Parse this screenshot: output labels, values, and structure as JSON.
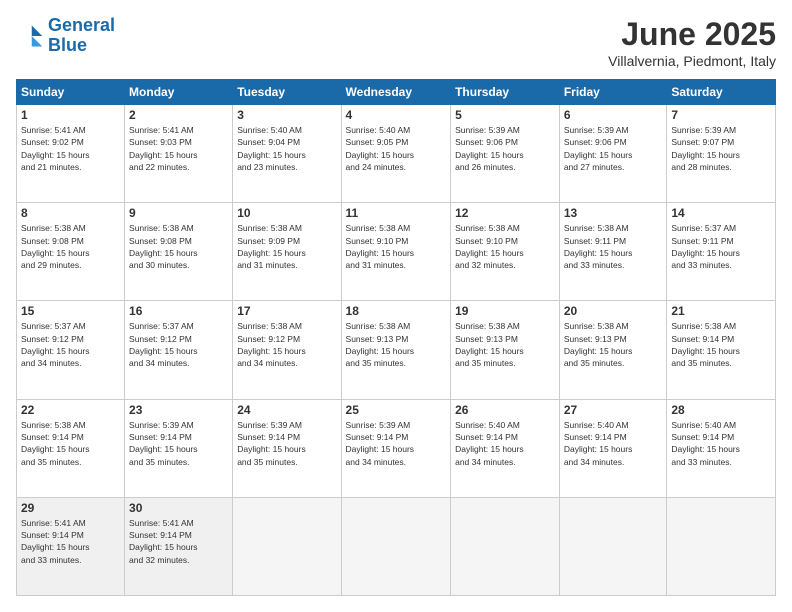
{
  "logo": {
    "line1": "General",
    "line2": "Blue"
  },
  "title": "June 2025",
  "subtitle": "Villalvernia, Piedmont, Italy",
  "weekdays": [
    "Sunday",
    "Monday",
    "Tuesday",
    "Wednesday",
    "Thursday",
    "Friday",
    "Saturday"
  ],
  "weeks": [
    [
      {
        "day": "1",
        "info": "Sunrise: 5:41 AM\nSunset: 9:02 PM\nDaylight: 15 hours\nand 21 minutes."
      },
      {
        "day": "2",
        "info": "Sunrise: 5:41 AM\nSunset: 9:03 PM\nDaylight: 15 hours\nand 22 minutes."
      },
      {
        "day": "3",
        "info": "Sunrise: 5:40 AM\nSunset: 9:04 PM\nDaylight: 15 hours\nand 23 minutes."
      },
      {
        "day": "4",
        "info": "Sunrise: 5:40 AM\nSunset: 9:05 PM\nDaylight: 15 hours\nand 24 minutes."
      },
      {
        "day": "5",
        "info": "Sunrise: 5:39 AM\nSunset: 9:06 PM\nDaylight: 15 hours\nand 26 minutes."
      },
      {
        "day": "6",
        "info": "Sunrise: 5:39 AM\nSunset: 9:06 PM\nDaylight: 15 hours\nand 27 minutes."
      },
      {
        "day": "7",
        "info": "Sunrise: 5:39 AM\nSunset: 9:07 PM\nDaylight: 15 hours\nand 28 minutes."
      }
    ],
    [
      {
        "day": "8",
        "info": "Sunrise: 5:38 AM\nSunset: 9:08 PM\nDaylight: 15 hours\nand 29 minutes."
      },
      {
        "day": "9",
        "info": "Sunrise: 5:38 AM\nSunset: 9:08 PM\nDaylight: 15 hours\nand 30 minutes."
      },
      {
        "day": "10",
        "info": "Sunrise: 5:38 AM\nSunset: 9:09 PM\nDaylight: 15 hours\nand 31 minutes."
      },
      {
        "day": "11",
        "info": "Sunrise: 5:38 AM\nSunset: 9:10 PM\nDaylight: 15 hours\nand 31 minutes."
      },
      {
        "day": "12",
        "info": "Sunrise: 5:38 AM\nSunset: 9:10 PM\nDaylight: 15 hours\nand 32 minutes."
      },
      {
        "day": "13",
        "info": "Sunrise: 5:38 AM\nSunset: 9:11 PM\nDaylight: 15 hours\nand 33 minutes."
      },
      {
        "day": "14",
        "info": "Sunrise: 5:37 AM\nSunset: 9:11 PM\nDaylight: 15 hours\nand 33 minutes."
      }
    ],
    [
      {
        "day": "15",
        "info": "Sunrise: 5:37 AM\nSunset: 9:12 PM\nDaylight: 15 hours\nand 34 minutes."
      },
      {
        "day": "16",
        "info": "Sunrise: 5:37 AM\nSunset: 9:12 PM\nDaylight: 15 hours\nand 34 minutes."
      },
      {
        "day": "17",
        "info": "Sunrise: 5:38 AM\nSunset: 9:12 PM\nDaylight: 15 hours\nand 34 minutes."
      },
      {
        "day": "18",
        "info": "Sunrise: 5:38 AM\nSunset: 9:13 PM\nDaylight: 15 hours\nand 35 minutes."
      },
      {
        "day": "19",
        "info": "Sunrise: 5:38 AM\nSunset: 9:13 PM\nDaylight: 15 hours\nand 35 minutes."
      },
      {
        "day": "20",
        "info": "Sunrise: 5:38 AM\nSunset: 9:13 PM\nDaylight: 15 hours\nand 35 minutes."
      },
      {
        "day": "21",
        "info": "Sunrise: 5:38 AM\nSunset: 9:14 PM\nDaylight: 15 hours\nand 35 minutes."
      }
    ],
    [
      {
        "day": "22",
        "info": "Sunrise: 5:38 AM\nSunset: 9:14 PM\nDaylight: 15 hours\nand 35 minutes."
      },
      {
        "day": "23",
        "info": "Sunrise: 5:39 AM\nSunset: 9:14 PM\nDaylight: 15 hours\nand 35 minutes."
      },
      {
        "day": "24",
        "info": "Sunrise: 5:39 AM\nSunset: 9:14 PM\nDaylight: 15 hours\nand 35 minutes."
      },
      {
        "day": "25",
        "info": "Sunrise: 5:39 AM\nSunset: 9:14 PM\nDaylight: 15 hours\nand 34 minutes."
      },
      {
        "day": "26",
        "info": "Sunrise: 5:40 AM\nSunset: 9:14 PM\nDaylight: 15 hours\nand 34 minutes."
      },
      {
        "day": "27",
        "info": "Sunrise: 5:40 AM\nSunset: 9:14 PM\nDaylight: 15 hours\nand 34 minutes."
      },
      {
        "day": "28",
        "info": "Sunrise: 5:40 AM\nSunset: 9:14 PM\nDaylight: 15 hours\nand 33 minutes."
      }
    ],
    [
      {
        "day": "29",
        "info": "Sunrise: 5:41 AM\nSunset: 9:14 PM\nDaylight: 15 hours\nand 33 minutes."
      },
      {
        "day": "30",
        "info": "Sunrise: 5:41 AM\nSunset: 9:14 PM\nDaylight: 15 hours\nand 32 minutes."
      },
      {
        "day": "",
        "info": ""
      },
      {
        "day": "",
        "info": ""
      },
      {
        "day": "",
        "info": ""
      },
      {
        "day": "",
        "info": ""
      },
      {
        "day": "",
        "info": ""
      }
    ]
  ]
}
